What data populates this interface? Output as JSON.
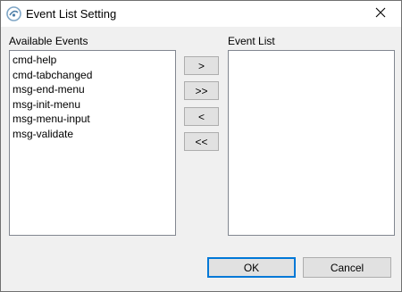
{
  "window": {
    "title": "Event List Setting",
    "app_icon": "app-logo-icon",
    "close_icon": "close-icon"
  },
  "available": {
    "label": "Available Events",
    "items": [
      "cmd-help",
      "cmd-tabchanged",
      "msg-end-menu",
      "msg-init-menu",
      "msg-menu-input",
      "msg-validate"
    ]
  },
  "event_list": {
    "label": "Event List",
    "items": []
  },
  "transfer_buttons": {
    "add": ">",
    "add_all": ">>",
    "remove": "<",
    "remove_all": "<<"
  },
  "footer": {
    "ok": "OK",
    "cancel": "Cancel"
  }
}
